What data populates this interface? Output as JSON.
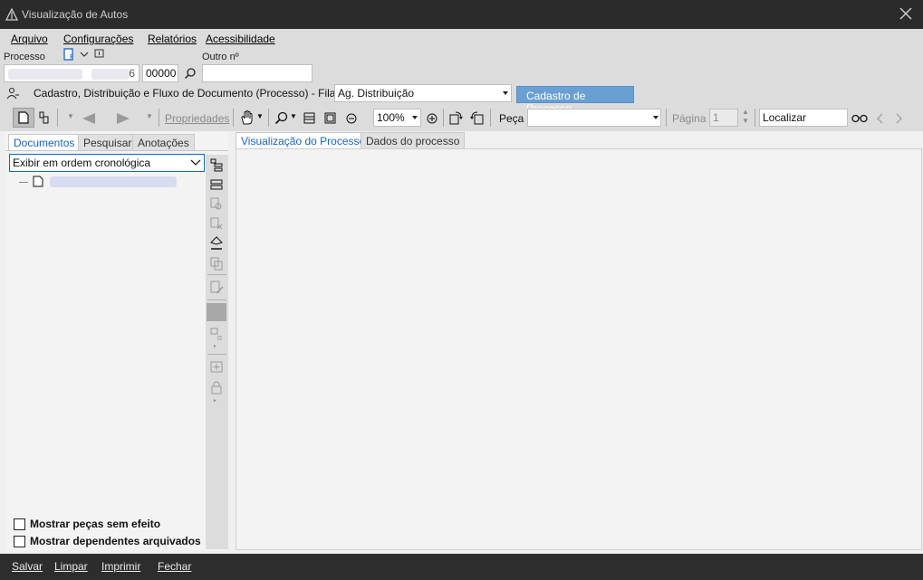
{
  "window": {
    "title": "Visualização de Autos"
  },
  "menu": [
    "Arquivo",
    "Configurações",
    "Relatórios",
    "Acessibilidade"
  ],
  "processo": {
    "label": "Processo",
    "suffix": "6",
    "code": "00000",
    "outro_label": "Outro nº",
    "outro_value": ""
  },
  "fila": {
    "label": "Cadastro, Distribuição e Fluxo de Documento (Processo) - Fila:",
    "value": "Ag. Distribuição",
    "button": "Cadastro de Processo"
  },
  "toolbar": {
    "propriedades": "Propriedades",
    "zoom": "100%",
    "peca_label": "Peça",
    "peca_value": "",
    "pagina_label": "Página",
    "pagina_value": "1",
    "localizar": "Localizar"
  },
  "left_tabs": [
    "Documentos",
    "Pesquisar",
    "Anotações"
  ],
  "order_select": "Exibir em ordem cronológica",
  "checkboxes": [
    "Mostrar peças sem efeito",
    "Mostrar dependentes arquivados"
  ],
  "right_tabs": [
    "Visualização do Processo",
    "Dados do processo"
  ],
  "footer": [
    "Salvar",
    "Limpar",
    "Imprimir",
    "Fechar"
  ],
  "colors": {
    "titlebar": "#2b2b2b",
    "accent": "#1a63c6",
    "button_blue": "#6a9fd4"
  }
}
